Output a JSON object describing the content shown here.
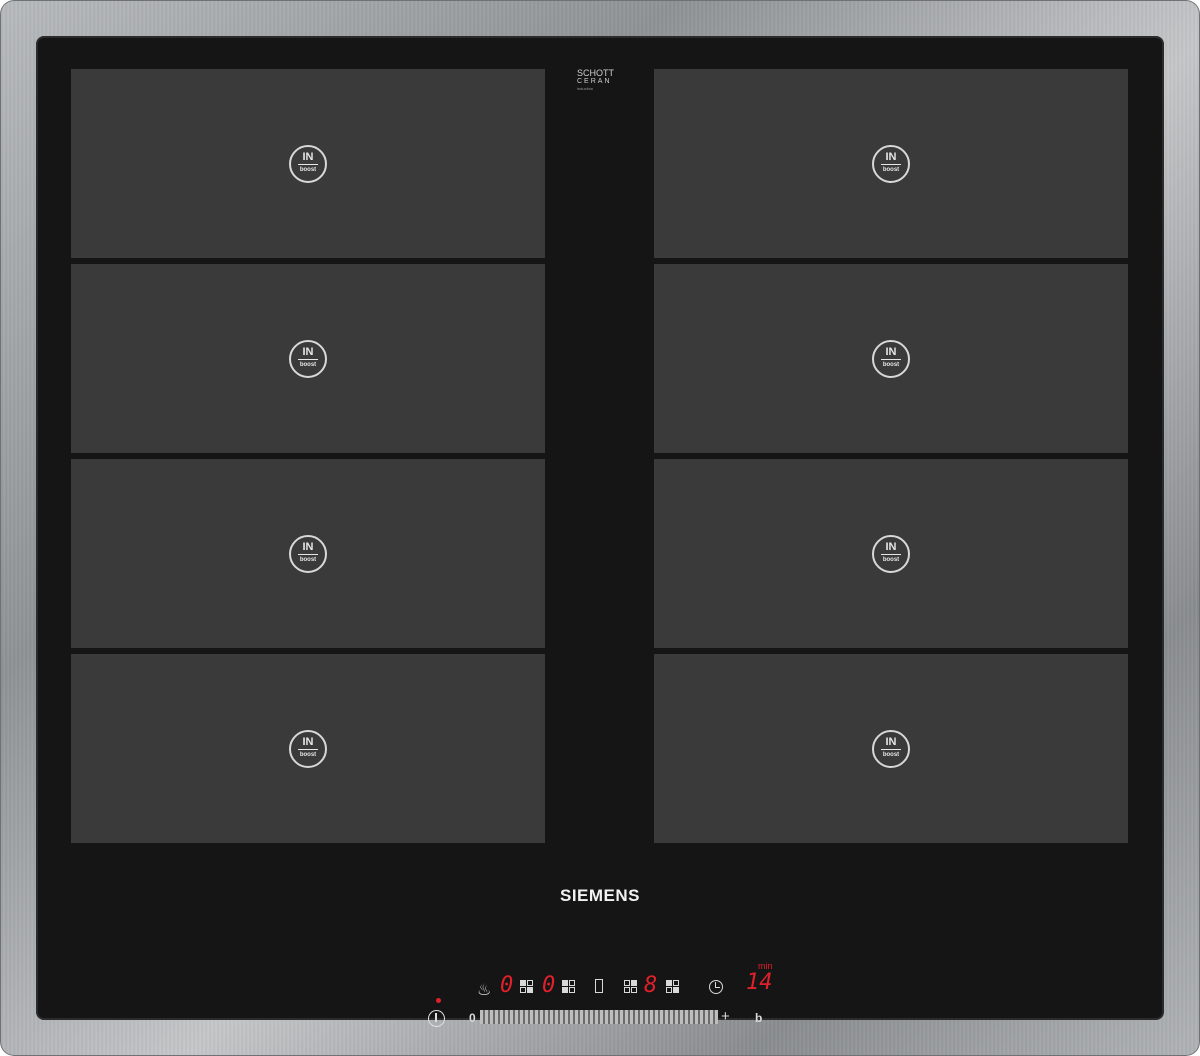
{
  "glass_badge": {
    "line1": "SCHOTT",
    "line2": "CERAN",
    "line3": "induction"
  },
  "zone_icon": {
    "top": "IN",
    "bottom": "boost"
  },
  "zones": [
    {
      "id": "left-1"
    },
    {
      "id": "left-2"
    },
    {
      "id": "left-3"
    },
    {
      "id": "left-4"
    },
    {
      "id": "right-1"
    },
    {
      "id": "right-2"
    },
    {
      "id": "right-3"
    },
    {
      "id": "right-4"
    }
  ],
  "brand": "SIEMENS",
  "controls": {
    "slider_min": "0",
    "slider_plus": "+",
    "boost_key": "b",
    "zone1_level": "0",
    "zone2_level": "0",
    "zone3_level": "8",
    "timer_unit": "min",
    "timer_value": "14"
  },
  "colors": {
    "display_red": "#e0202a",
    "glass": "#151515",
    "zone": "#3a3a3a"
  }
}
